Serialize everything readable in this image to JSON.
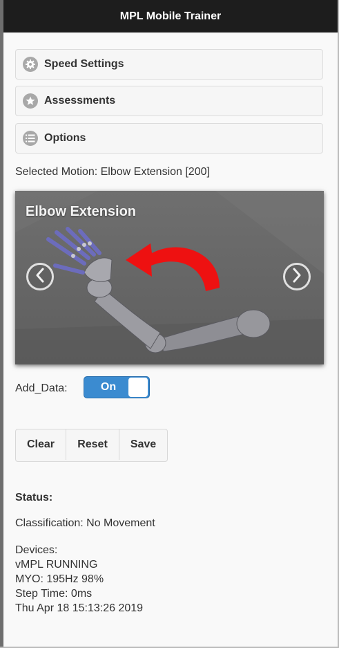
{
  "app": {
    "title": "MPL Mobile Trainer"
  },
  "panels": [
    {
      "label": "Speed Settings",
      "icon": "gear-icon"
    },
    {
      "label": "Assessments",
      "icon": "star-icon"
    },
    {
      "label": "Options",
      "icon": "list-icon"
    }
  ],
  "selected_motion": "Selected Motion: Elbow Extension [200]",
  "carousel": {
    "title": "Elbow Extension",
    "prev_icon": "chevron-left-icon",
    "next_icon": "chevron-right-icon"
  },
  "add_data": {
    "label": "Add_Data:",
    "toggle_label": "On",
    "state": "on"
  },
  "actions": {
    "clear": "Clear",
    "reset": "Reset",
    "save": "Save"
  },
  "status": {
    "title": "Status:",
    "classification": "Classification: No Movement",
    "devices_label": "Devices:",
    "lines": [
      "vMPL RUNNING",
      "MYO: 195Hz 98%",
      "Step Time: 0ms",
      "Thu Apr 18 15:13:26 2019"
    ]
  },
  "colors": {
    "header_bg": "#1d1d1d",
    "toggle_on": "#3b8bd0",
    "arrow_red": "#ee1111",
    "page_bg": "#f9f9f9"
  }
}
